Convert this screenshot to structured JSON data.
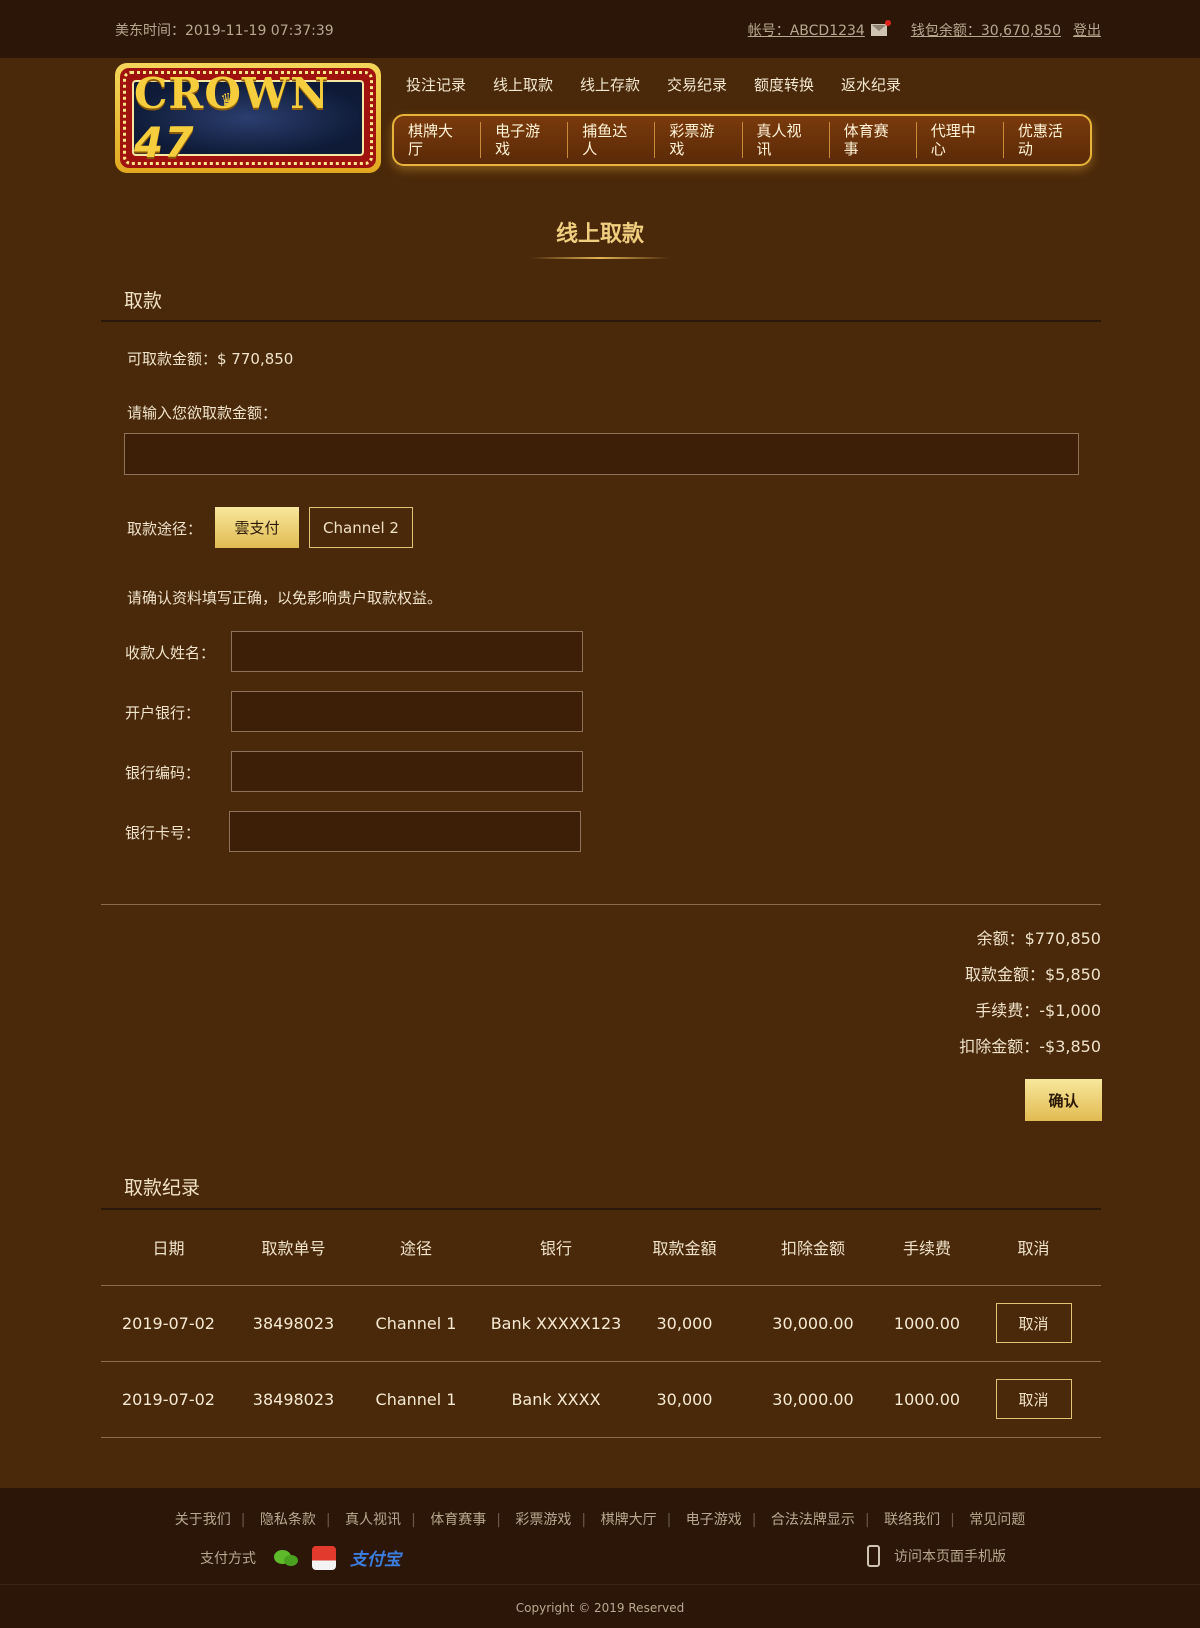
{
  "topbar": {
    "time": "美东时间：2019-11-19 07:37:39",
    "account": "帐号：ABCD1234",
    "wallet": "钱包余额：30,670,850",
    "logout": "登出"
  },
  "logo": {
    "brand": "CROWN",
    "number": "47"
  },
  "nav_top": [
    "投注记录",
    "线上取款",
    "线上存款",
    "交易纪录",
    "额度转换",
    "返水纪录"
  ],
  "nav_main": [
    "棋牌大厅",
    "电子游戏",
    "捕鱼达人",
    "彩票游戏",
    "真人视讯",
    "体育赛事",
    "代理中心",
    "优惠活动"
  ],
  "page_title": "线上取款",
  "withdraw": {
    "section_title": "取款",
    "available": "可取款金额：$ 770,850",
    "amount_prompt": "请输入您欲取款金额：",
    "amount_value": "",
    "channel_label": "取款途径：",
    "channels": [
      "雲支付",
      "Channel 2"
    ],
    "active_channel": "雲支付",
    "notice": "请确认资料填写正确，以免影响贵户取款权益。",
    "fields": [
      {
        "label": "收款人姓名：",
        "value": ""
      },
      {
        "label": "开户银行：",
        "value": ""
      },
      {
        "label": "银行编码：",
        "value": ""
      },
      {
        "label": "银行卡号：",
        "value": ""
      }
    ]
  },
  "summary": {
    "balance": "余额：$770,850",
    "amount": "取款金额：$5,850",
    "fee": "手续费：-$1,000",
    "deduct": "扣除金额：-$3,850",
    "confirm": "确认"
  },
  "records": {
    "section_title": "取款纪录",
    "headers": [
      "日期",
      "取款单号",
      "途径",
      "银行",
      "取款金額",
      "扣除金额",
      "手续费",
      "取消"
    ],
    "rows": [
      {
        "date": "2019-07-02",
        "order": "38498023",
        "channel": "Channel 1",
        "bank": "Bank XXXXX123",
        "amount": "30,000",
        "deduct": "30,000.00",
        "fee": "1000.00",
        "cancel": "取消"
      },
      {
        "date": "2019-07-02",
        "order": "38498023",
        "channel": "Channel 1",
        "bank": "Bank XXXX",
        "amount": "30,000",
        "deduct": "30,000.00",
        "fee": "1000.00",
        "cancel": "取消"
      }
    ]
  },
  "footer": {
    "links": [
      "关于我们",
      "隐私条款",
      "真人视讯",
      "体育赛事",
      "彩票游戏",
      "棋牌大厅",
      "电子游戏",
      "合法法牌显示",
      "联络我们",
      "常见问题"
    ],
    "payment_label": "支付方式",
    "alipay_text": "支付宝",
    "mobile_text": "访问本页面手机版",
    "copyright": "Copyright © 2019 Reserved"
  }
}
